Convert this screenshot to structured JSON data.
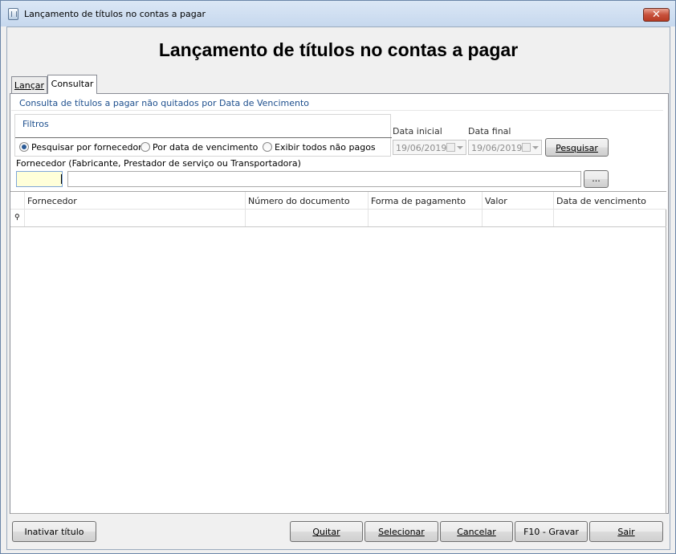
{
  "window": {
    "title": "Lançamento de títulos no contas a pagar",
    "close_glyph": "✕"
  },
  "header": {
    "title": "Lançamento de títulos no contas a pagar"
  },
  "tabs": [
    {
      "label": "Lançar",
      "active": false
    },
    {
      "label": "Consultar",
      "active": true
    }
  ],
  "consultar": {
    "subtitle": "Consulta de títulos a pagar não quitados por Data de Vencimento",
    "filters": {
      "group_label": "Filtros",
      "options": [
        {
          "label": "Pesquisar por fornecedor",
          "checked": true
        },
        {
          "label": "Por data de vencimento",
          "checked": false
        },
        {
          "label": "Exibir todos não pagos",
          "checked": false
        }
      ]
    },
    "start_date": {
      "label": "Data inicial",
      "value": "19/06/2019"
    },
    "end_date": {
      "label": "Data final",
      "value": "19/06/2019"
    },
    "search_button": "Pesquisar",
    "supplier": {
      "label": "Fornecedor (Fabricante, Prestador de serviço ou Transportadora)",
      "code_value": "",
      "name_value": "",
      "lookup_button": "..."
    },
    "grid": {
      "columns": [
        "Fornecedor",
        "Número do documento",
        "Forma de pagamento",
        "Valor",
        "Data de vencimento"
      ],
      "new_row_glyph": "⚲"
    }
  },
  "footer": {
    "inactivate_button": "Inativar título",
    "quitar_button": "Quitar",
    "select_button": "Selecionar",
    "cancel_button": "Cancelar",
    "save_button": "F10 - Gravar",
    "exit_button": "Sair"
  }
}
